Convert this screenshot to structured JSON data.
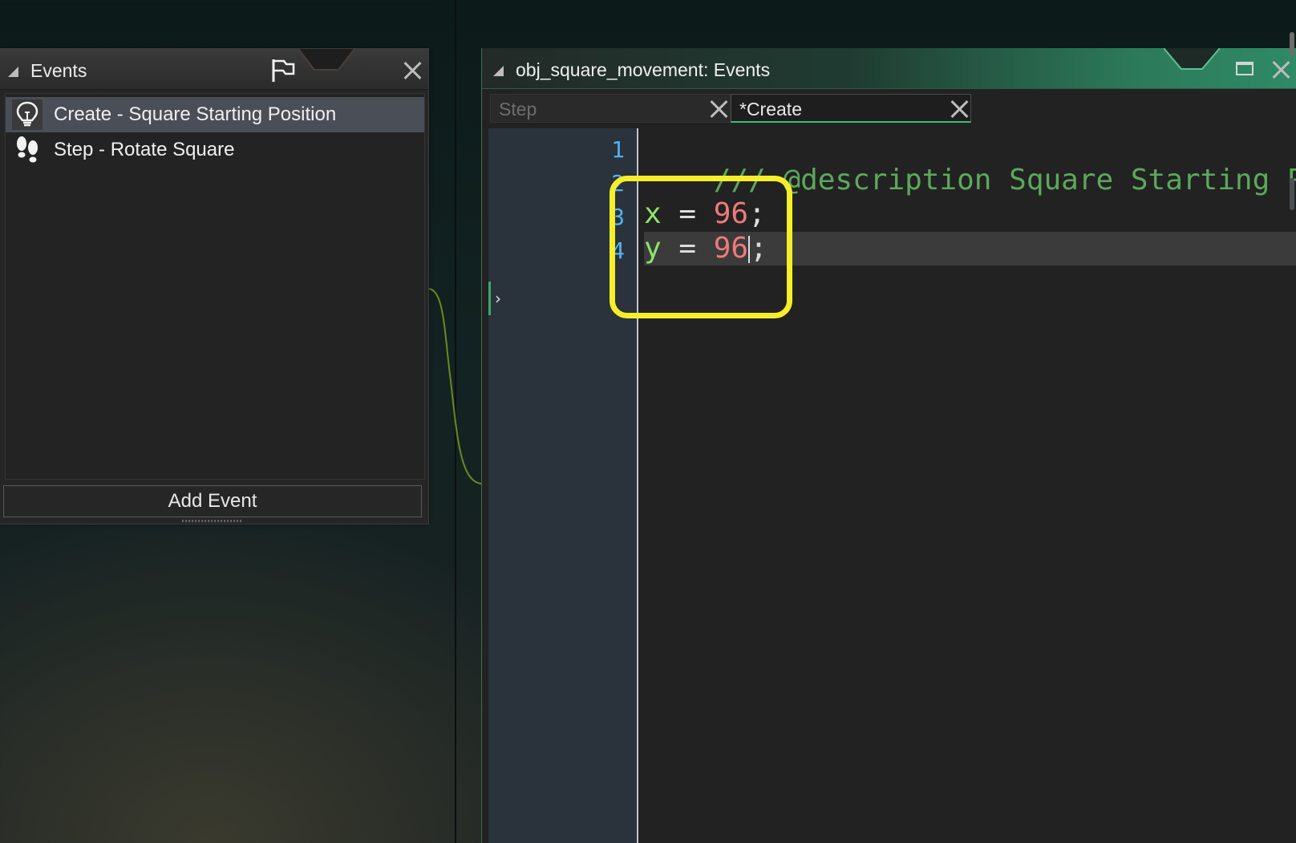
{
  "events_panel": {
    "title": "Events",
    "items": [
      {
        "label": "Create - Square Starting Position",
        "icon": "lightbulb-icon",
        "selected": true
      },
      {
        "label": "Step - Rotate Square",
        "icon": "footsteps-icon",
        "selected": false
      }
    ],
    "add_button_label": "Add Event"
  },
  "code_editor": {
    "title": "obj_square_movement: Events",
    "tabs": [
      {
        "label": "Step",
        "active": false
      },
      {
        "label": "*Create",
        "active": true
      }
    ],
    "line_numbers": [
      "1",
      "2",
      "3",
      "4"
    ],
    "lines": {
      "l1": "/// @description Square Starting Pos",
      "l3_var": "x",
      "l3_op": " = ",
      "l3_num": "96",
      "l3_end": ";",
      "l4_var": "y",
      "l4_op": " = ",
      "l4_num": "96",
      "l4_end": ";"
    },
    "colors": {
      "comment": "#5ca85c",
      "variable": "#8ee26b",
      "number": "#f07a7a",
      "line_number": "#4fb3f0",
      "highlight": "#f6ee2a"
    }
  }
}
